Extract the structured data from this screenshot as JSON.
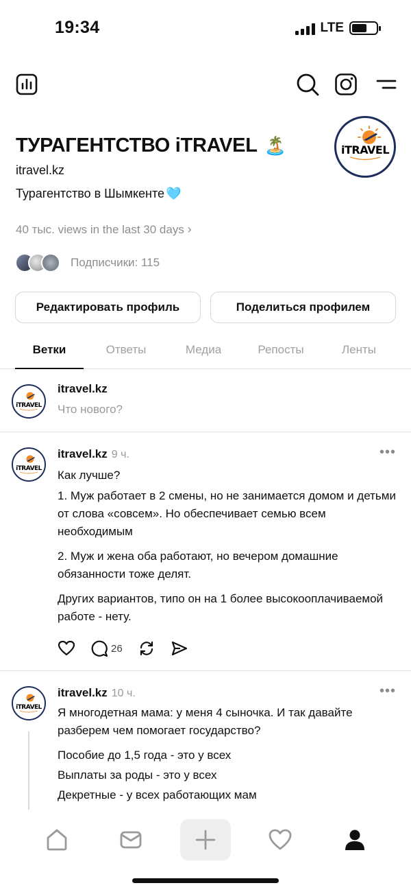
{
  "status_bar": {
    "time": "19:34",
    "network": "LTE",
    "battery_level": 0.62
  },
  "top_nav": {
    "icons": [
      "insights-icon",
      "search-icon",
      "instagram-icon",
      "menu-icon"
    ]
  },
  "profile": {
    "name": "ТУРАГЕНТСТВО iTRAVEL",
    "name_emoji": "🏝️",
    "handle": "itravel.kz",
    "bio": "Турагентство в Шымкенте",
    "bio_emoji": "🩵",
    "views": "40 тыс. views in the last 30 days",
    "followers": "Подписчики: 115",
    "logo_text": "iTRAVEL"
  },
  "buttons": {
    "edit": "Редактировать профиль",
    "share": "Поделиться профилем"
  },
  "tabs": [
    {
      "label": "Ветки",
      "active": true
    },
    {
      "label": "Ответы",
      "active": false
    },
    {
      "label": "Медиа",
      "active": false
    },
    {
      "label": "Репосты",
      "active": false
    },
    {
      "label": "Ленты",
      "active": false
    }
  ],
  "composer": {
    "username": "itravel.kz",
    "placeholder": "Что нового?"
  },
  "posts": [
    {
      "username": "itravel.kz",
      "time": "9 ч.",
      "paragraphs": [
        "Как лучше?",
        "1. Муж работает в 2 смены, но не занимается домом и детьми от слова «совсем». Но обеспечивает семью всем необходимым",
        "2. Муж и жена оба работают, но вечером домашние обязанности тоже делят.",
        "Других вариантов, типо он на 1 более высокооплачиваемой работе - нету."
      ],
      "comment_count": "26"
    },
    {
      "username": "itravel.kz",
      "time": "10 ч.",
      "paragraphs": [
        "Я многодетная мама: у меня 4 сыночка. И так давайте разберем чем помогает государство?",
        "Пособие до 1,5 года - это у всех",
        "Выплаты за роды - это у всех",
        "Декретные - у всех работающих мам"
      ]
    }
  ],
  "bottom_nav": {
    "icons": [
      "home-icon",
      "inbox-icon",
      "plus-icon",
      "heart-icon",
      "profile-icon"
    ],
    "active": "profile-icon"
  },
  "colors": {
    "text": "#101010",
    "muted": "#9a9a9a",
    "logo_navy": "#1d2d5c",
    "logo_orange": "#f28c28",
    "divider": "#e2e2e2"
  }
}
